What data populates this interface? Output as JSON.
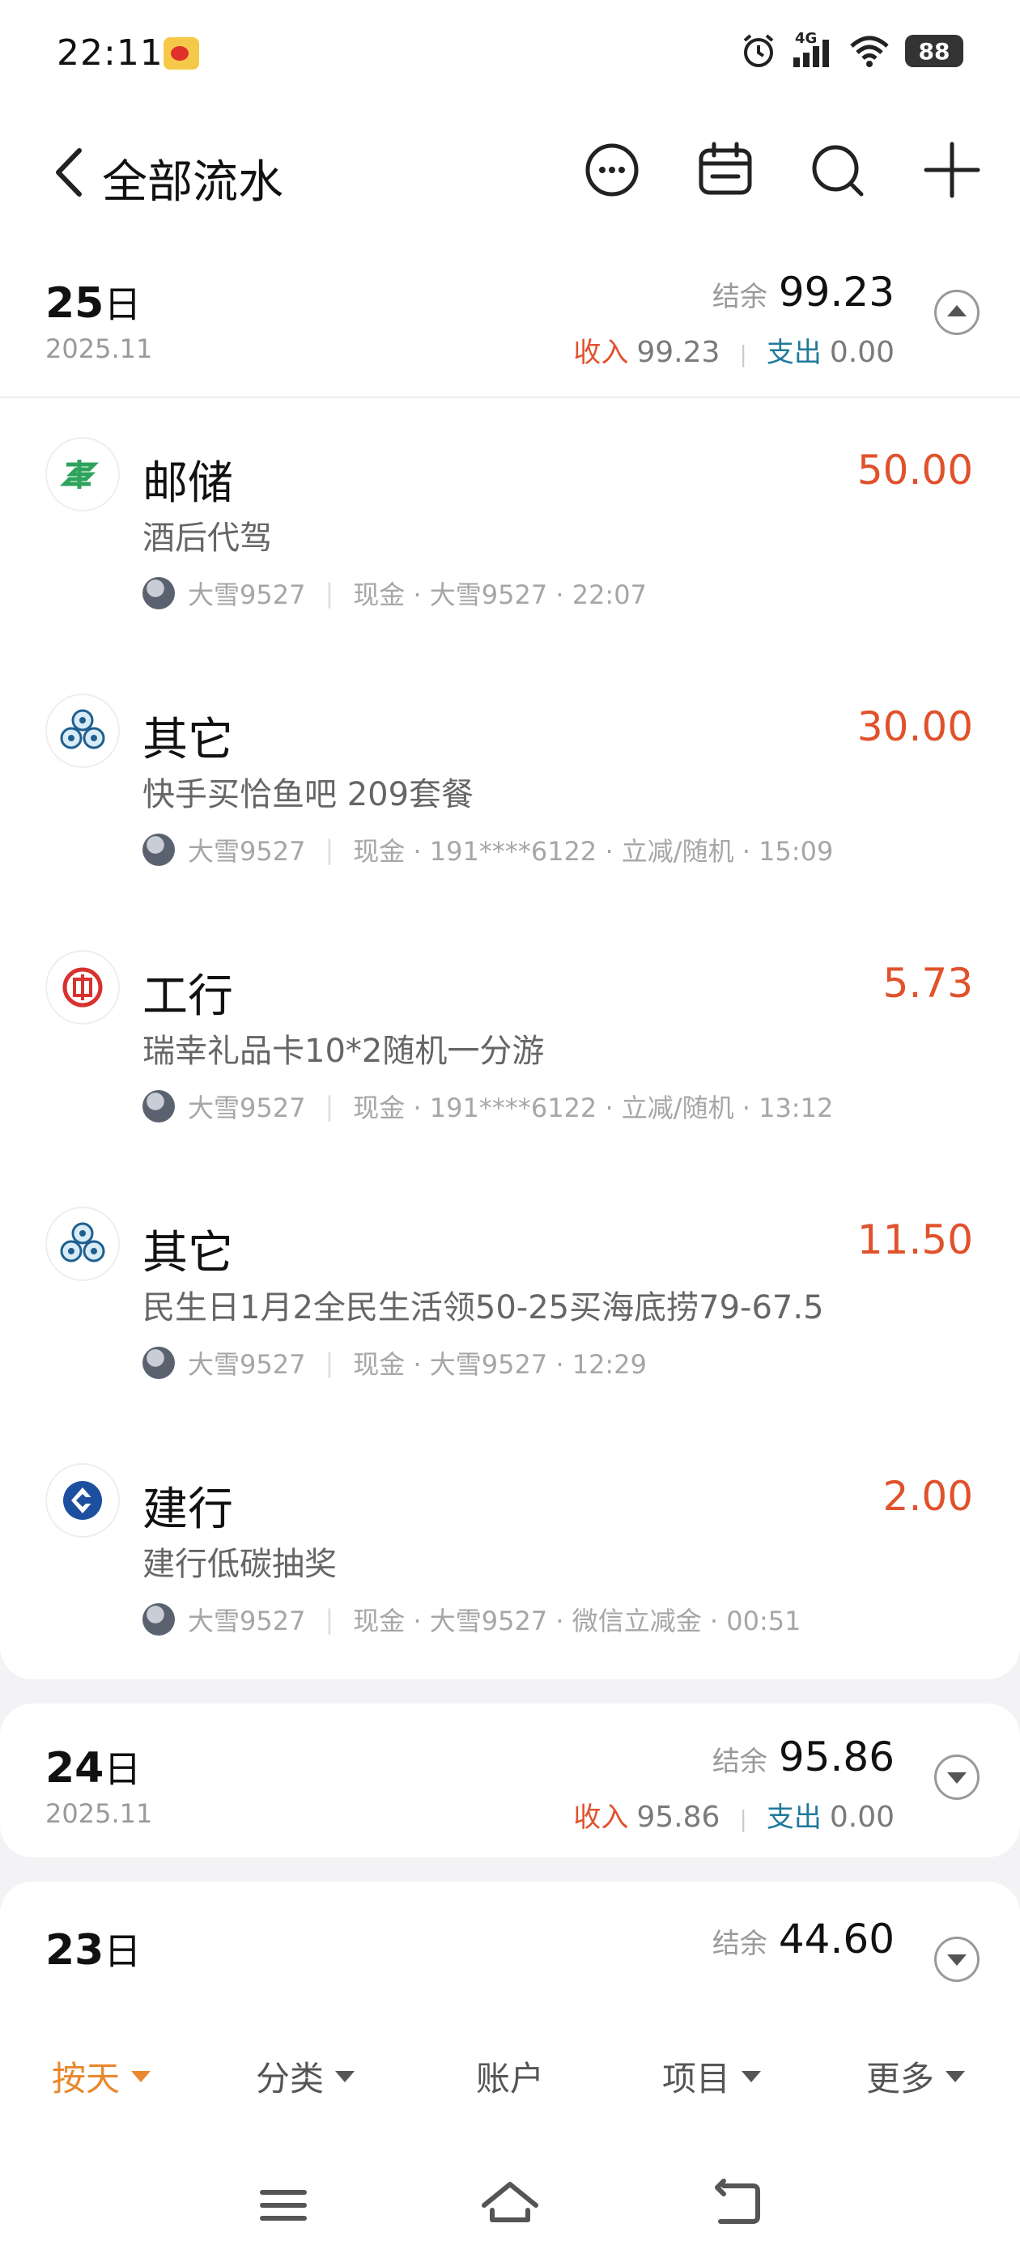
{
  "status_bar": {
    "time": "22:11",
    "network": "4G",
    "battery": "88"
  },
  "header": {
    "title": "全部流水",
    "icons": [
      "back-icon",
      "more-icon",
      "calendar-icon",
      "search-icon",
      "add-icon"
    ]
  },
  "days": [
    {
      "day": "25",
      "day_suffix": "日",
      "year_month": "2025.11",
      "balance_label": "结余",
      "balance": "99.23",
      "income_label": "收入",
      "income": "99.23",
      "expense_label": "支出",
      "expense": "0.00",
      "expanded": true,
      "transactions": [
        {
          "category": "邮储",
          "icon": "postal-bank-icon",
          "amount": "50.00",
          "note": "酒后代驾",
          "user": "大雪9527",
          "details": "现金 · 大雪9527 · 22:07"
        },
        {
          "category": "其它",
          "icon": "other-category-icon",
          "amount": "30.00",
          "note": "快手买恰鱼吧 209套餐",
          "user": "大雪9527",
          "details": "现金 · 191****6122 · 立减/随机 · 15:09"
        },
        {
          "category": "工行",
          "icon": "icbc-icon",
          "amount": "5.73",
          "note": "瑞幸礼品卡10*2随机一分游",
          "user": "大雪9527",
          "details": "现金 · 191****6122 · 立减/随机 · 13:12"
        },
        {
          "category": "其它",
          "icon": "other-category-icon",
          "amount": "11.50",
          "note": "民生日1月2全民生活领50-25买海底捞79-67.5",
          "user": "大雪9527",
          "details": "现金 · 大雪9527 · 12:29"
        },
        {
          "category": "建行",
          "icon": "ccb-icon",
          "amount": "2.00",
          "note": "建行低碳抽奖",
          "user": "大雪9527",
          "details": "现金 · 大雪9527 · 微信立减金 · 00:51"
        }
      ]
    },
    {
      "day": "24",
      "day_suffix": "日",
      "year_month": "2025.11",
      "balance_label": "结余",
      "balance": "95.86",
      "income_label": "收入",
      "income": "95.86",
      "expense_label": "支出",
      "expense": "0.00",
      "expanded": false
    },
    {
      "day": "23",
      "day_suffix": "日",
      "balance_label": "结余",
      "balance": "44.60",
      "expanded": false
    }
  ],
  "bottom_tabs": [
    {
      "label": "按天",
      "active": true,
      "has_caret": true
    },
    {
      "label": "分类",
      "active": false,
      "has_caret": true
    },
    {
      "label": "账户",
      "active": false,
      "has_caret": false
    },
    {
      "label": "项目",
      "active": false,
      "has_caret": true
    },
    {
      "label": "更多",
      "active": false,
      "has_caret": true
    }
  ],
  "nav_bar": [
    "menu-icon",
    "home-icon",
    "back-nav-icon"
  ],
  "colors": {
    "income": "#e0522c",
    "expense_label": "#1f7a9b",
    "active_tab": "#e8882e"
  }
}
